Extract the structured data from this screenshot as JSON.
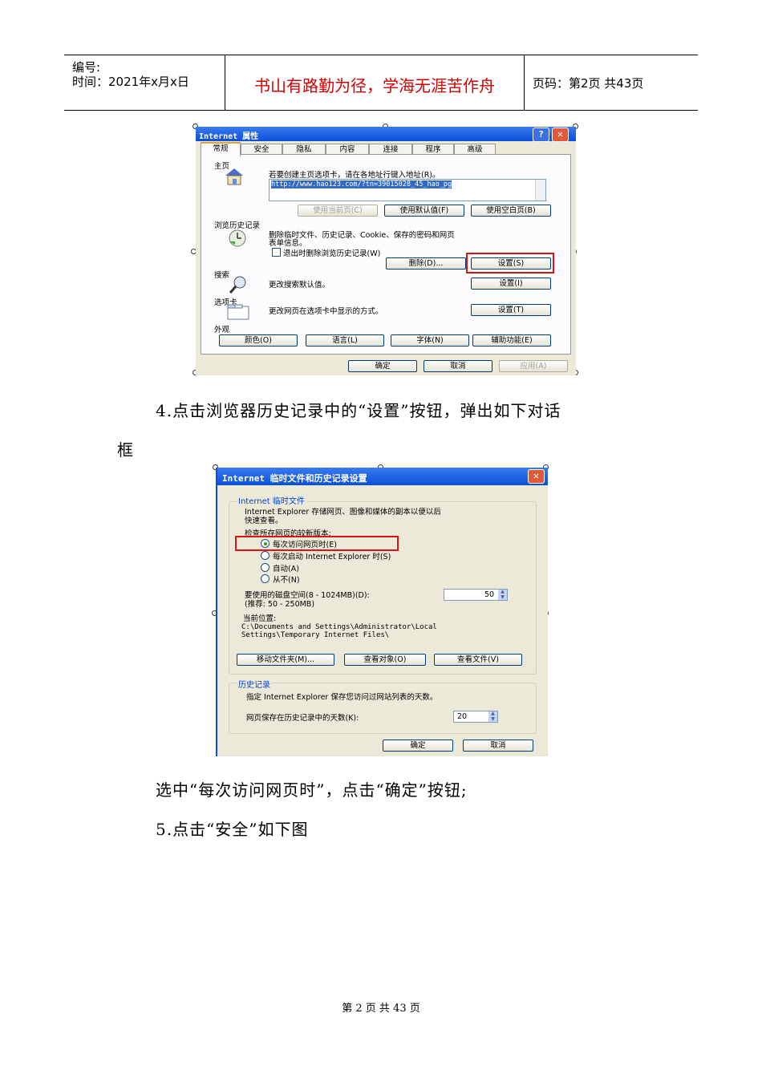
{
  "header": {
    "number_label": "编号:",
    "time_label": "时间：2021年x月x日",
    "motto": "书山有路勤为径，学海无涯苦作舟",
    "page_info": "页码：第2页  共43页"
  },
  "dialog1": {
    "title": "Internet 属性",
    "help_glyph": "?",
    "close_glyph": "✕",
    "tabs": [
      "常规",
      "安全",
      "隐私",
      "内容",
      "连接",
      "程序",
      "高级"
    ],
    "home": {
      "section": "主页",
      "desc": "若要创建主页选项卡，请在各地址行键入地址(R)。",
      "url": "http://www.hao123.com/?tn=39015028_45_hao_pg",
      "btn_current": "使用当前页(C)",
      "btn_default": "使用默认值(F)",
      "btn_blank": "使用空白页(B)"
    },
    "history": {
      "section": "浏览历史记录",
      "desc1": "删除临时文件、历史记录、Cookie、保存的密码和网页",
      "desc2": "表单信息。",
      "checkbox": "退出时删除浏览历史记录(W)",
      "btn_delete": "删除(D)...",
      "btn_settings": "设置(S)"
    },
    "search": {
      "section": "搜索",
      "desc": "更改搜索默认值。",
      "btn_settings": "设置(I)"
    },
    "tabs_section": {
      "section": "选项卡",
      "desc": "更改网页在选项卡中显示的方式。",
      "btn_settings": "设置(T)"
    },
    "appearance": {
      "section": "外观",
      "btn_colors": "颜色(O)",
      "btn_languages": "语言(L)",
      "btn_fonts": "字体(N)",
      "btn_accessibility": "辅助功能(E)"
    },
    "btn_ok": "确定",
    "btn_cancel": "取消",
    "btn_apply": "应用(A)"
  },
  "para4_line1": "4.点击浏览器历史记录中的“设置”按钮，弹出如下对话",
  "para4_line2": "框",
  "dialog2": {
    "title": "Internet 临时文件和历史记录设置",
    "close_glyph": "✕",
    "temp_group": "Internet 临时文件",
    "desc1": "Internet Explorer 存储网页、图像和媒体的副本以便以后",
    "desc2": "快速查看。",
    "check_label": "检查所存网页的较新版本:",
    "options": [
      "每次访问网页时(E)",
      "每次启动 Internet Explorer 时(S)",
      "自动(A)",
      "从不(N)"
    ],
    "disk_label": "要使用的磁盘空间(8 - 1024MB)(D):",
    "disk_recommend": "(推荐: 50 - 250MB)",
    "disk_value": "50",
    "location_label": "当前位置:",
    "location1": "C:\\Documents and Settings\\Administrator\\Local",
    "location2": "Settings\\Temporary Internet Files\\",
    "btn_move": "移动文件夹(M)...",
    "btn_objects": "查看对象(O)",
    "btn_files": "查看文件(V)",
    "history_group": "历史记录",
    "history_desc": "指定 Internet Explorer 保存您访问过网站列表的天数。",
    "days_label": "网页保存在历史记录中的天数(K):",
    "days_value": "20",
    "btn_ok": "确定",
    "btn_cancel": "取消"
  },
  "para_select": "选中“每次访问网页时”，点击“确定”按钮;",
  "para5": "5.点击“安全”如下图",
  "footer": "第 2 页 共 43 页"
}
